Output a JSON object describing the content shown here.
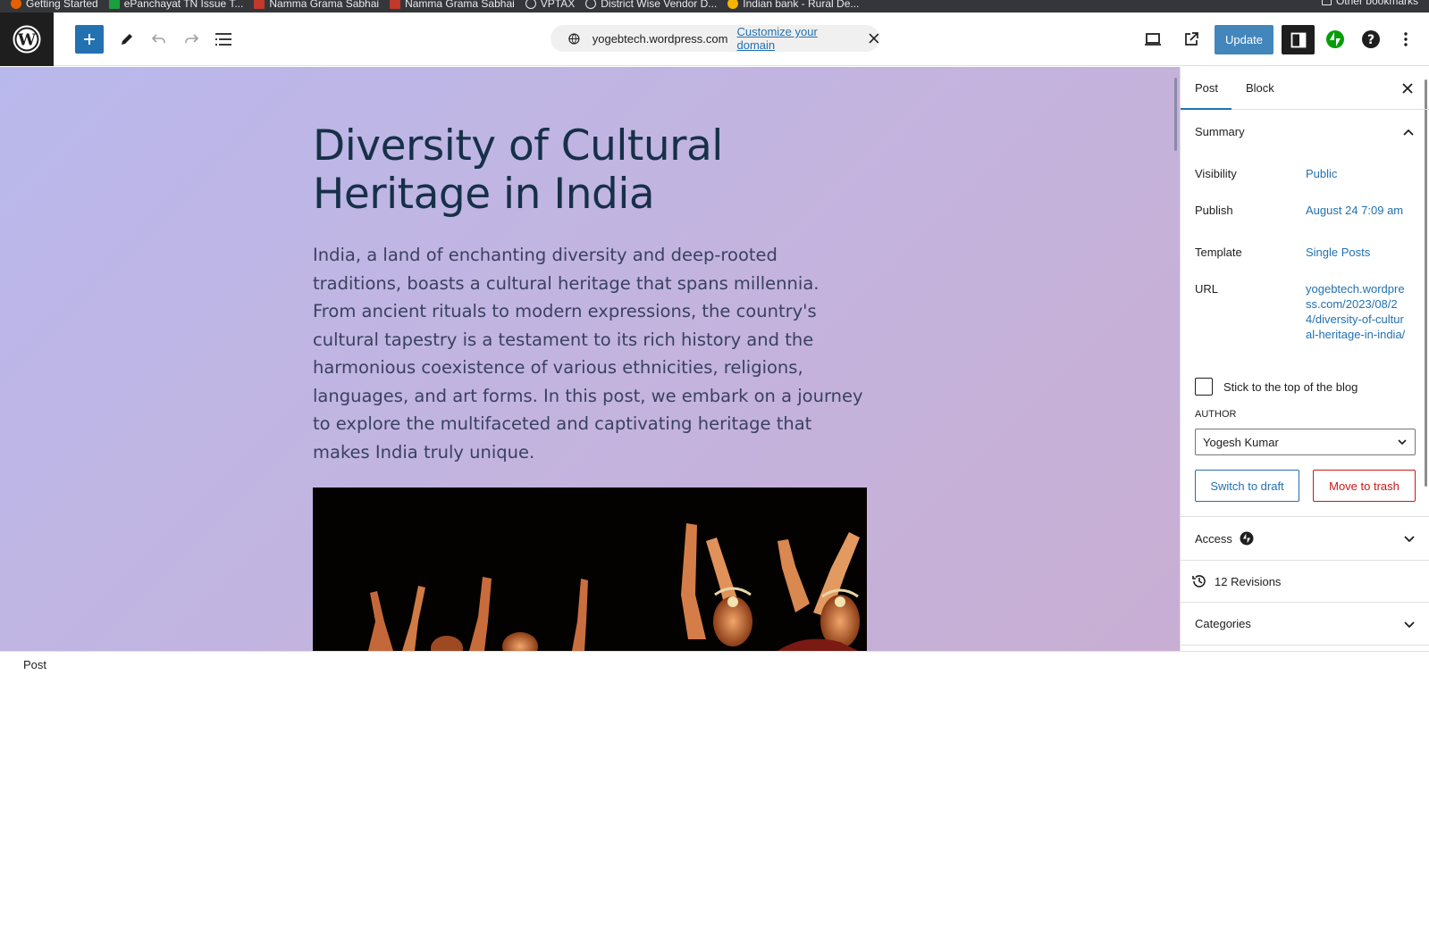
{
  "bookmarks": [
    {
      "label": "Getting Started",
      "color": "#e66000"
    },
    {
      "label": "ePanchayat TN Issue T...",
      "color": "#1a9e3f"
    },
    {
      "label": "Namma Grama Sabhai",
      "color": "#c0392b"
    },
    {
      "label": "Namma Grama Sabhai",
      "color": "#c0392b"
    },
    {
      "label": "VPTAX",
      "color": "#e8eaed"
    },
    {
      "label": "District Wise Vendor D...",
      "color": "#e8eaed"
    },
    {
      "label": "Indian bank - Rural De...",
      "color": "#f5b400"
    }
  ],
  "bookmarks_other": "Other bookmarks",
  "toolbar": {
    "site_url": "yogebtech.wordpress.com",
    "customize_domain": "Customize your domain",
    "update": "Update"
  },
  "post": {
    "title": "Diversity of Cultural Heritage in India",
    "body": "India, a land of enchanting diversity and deep-rooted traditions, boasts a cultural heritage that spans millennia. From ancient rituals to modern expressions, the country's cultural tapestry is a testament to its rich history and the harmonious coexistence of various ethnicities, religions, languages, and art forms. In this post, we embark on a journey to explore the multifaceted and captivating heritage that makes India truly unique."
  },
  "sidebar": {
    "tabs": [
      "Post",
      "Block"
    ],
    "summary": "Summary",
    "visibility_label": "Visibility",
    "visibility_value": "Public",
    "publish_label": "Publish",
    "publish_value": "August 24 7:09 am",
    "template_label": "Template",
    "template_value": "Single Posts",
    "url_label": "URL",
    "url_value": "yogebtech.wordpress.com/2023/08/24/diversity-of-cultural-heritage-in-india/",
    "sticky_label": "Stick to the top of the blog",
    "author_label": "AUTHOR",
    "author_value": "Yogesh Kumar",
    "switch_draft": "Switch to draft",
    "move_trash": "Move to trash",
    "access": "Access",
    "revisions": "12 Revisions",
    "categories": "Categories"
  },
  "footer": {
    "breadcrumb": "Post"
  },
  "colors": {
    "accent": "#2271b1",
    "danger": "#cc1818",
    "jetpack": "#069e08",
    "title": "#173049"
  }
}
